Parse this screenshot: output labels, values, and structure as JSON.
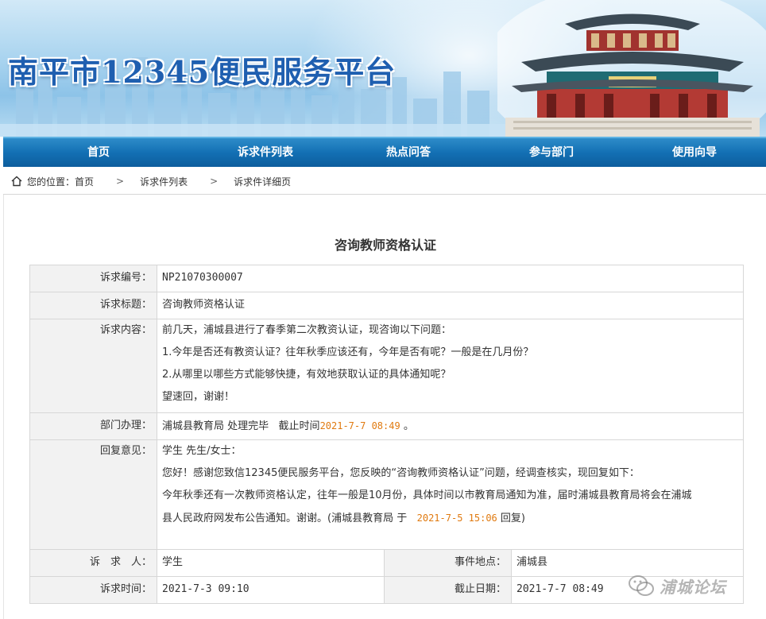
{
  "site": {
    "title": "南平市12345便民服务平台"
  },
  "nav": {
    "items": [
      {
        "label": "首页"
      },
      {
        "label": "诉求件列表"
      },
      {
        "label": "热点问答"
      },
      {
        "label": "参与部门"
      },
      {
        "label": "使用向导"
      }
    ]
  },
  "breadcrumb": {
    "prefix": "您的位置：",
    "items": [
      "首页",
      "诉求件列表",
      "诉求件详细页"
    ],
    "separator": ">"
  },
  "page": {
    "title": "咨询教师资格认证"
  },
  "detail": {
    "number_label": "诉求编号：",
    "number_value": "NP21070300007",
    "title_label": "诉求标题：",
    "title_value": "咨询教师资格认证",
    "content_label": "诉求内容：",
    "content_lines": [
      "前几天，浦城县进行了春季第二次教资认证，现咨询以下问题：",
      "1.今年是否还有教资认证？往年秋季应该还有，今年是否有呢？一般是在几月份？",
      "2.从哪里以哪些方式能够快捷，有效地获取认证的具体通知呢？",
      "望速回，谢谢！"
    ],
    "dept_label": "部门办理：",
    "dept_value": "浦城县教育局 处理完毕",
    "deadline_prefix": "截止时间",
    "deadline_time": "2021-7-7 08:49",
    "deadline_suffix": "。",
    "reply_label": "回复意见：",
    "reply_greeting": "学生 先生/女士：",
    "reply_line1": "您好！感谢您致信12345便民服务平台，您反映的“咨询教师资格认证”问题，经调查核实，现回复如下：",
    "reply_line2": "今年秋季还有一次教师资格认定，往年一般是10月份，具体时间以市教育局通知为准，届时浦城县教育局将会在浦城",
    "reply_line3_a": "县人民政府网发布公告通知。谢谢。(浦城县教育局 于",
    "reply_time": "2021-7-5 15:06",
    "reply_line3_b": "回复)",
    "person_label": "诉　求　人：",
    "person_value": "学生",
    "location_label": "事件地点：",
    "location_value": "浦城县",
    "time_label": "诉求时间：",
    "time_value": "2021-7-3 09:10",
    "due_label": "截止日期：",
    "due_value": "2021-7-7 08:49"
  },
  "watermark": {
    "text": "浦城论坛"
  },
  "colors": {
    "nav_bg": "#1370b4",
    "title_blue": "#1f5fb0",
    "highlight": "#e07a10"
  }
}
